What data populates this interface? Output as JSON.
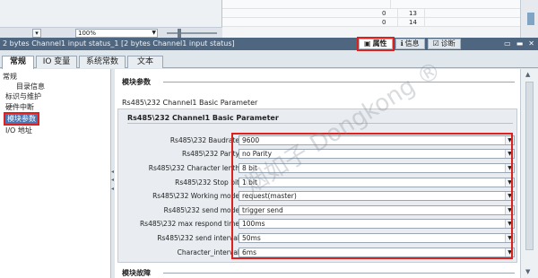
{
  "toolbar": {
    "zoom_value": "100%",
    "table_rows": [
      {
        "col1": "",
        "col2": "",
        "col3": ""
      },
      {
        "col1": "0",
        "col2": "13",
        "col3": ""
      },
      {
        "col1": "0",
        "col2": "14",
        "col3": ""
      }
    ]
  },
  "infobar": {
    "title": "2 bytes Channel1 input status_1 [2 bytes Channel1 input status]",
    "tabs": [
      {
        "label": "属性",
        "icon": "properties-icon"
      },
      {
        "label": "信息",
        "icon": "info-icon"
      },
      {
        "label": "诊断",
        "icon": "diagnostics-icon"
      }
    ]
  },
  "subtabs": [
    "常规",
    "IO 变量",
    "系统常数",
    "文本"
  ],
  "nav": {
    "items": [
      "常规",
      "目录信息",
      "标识与维护",
      "硬件中断",
      "模块参数",
      "I/O 地址"
    ]
  },
  "main": {
    "section_title": "模块参数",
    "group_title": "Rs485\\232 Channel1 Basic Parameter",
    "box_title": "Rs485\\232 Channel1 Basic Parameter",
    "params": [
      {
        "label": "Rs485\\232 Baudrate",
        "value": "9600"
      },
      {
        "label": "Rs485\\232 Parity",
        "value": "no Parity"
      },
      {
        "label": "Rs485\\232 Character lenth",
        "value": "8 bit"
      },
      {
        "label": "Rs485\\232 Stop bit",
        "value": "1 bit"
      },
      {
        "label": "Rs485\\232 Working mode",
        "value": "request(master)"
      },
      {
        "label": "Rs485\\232 send mode",
        "value": "trigger send"
      },
      {
        "label": "Rs485\\232 max respond time",
        "value": "100ms"
      },
      {
        "label": "Rs485\\232 send interval",
        "value": "50ms"
      },
      {
        "label": "Character_interval",
        "value": "6ms"
      }
    ],
    "footer_section": "模块故障"
  },
  "watermark": "烟如子 Dongkong ®",
  "colors": {
    "highlight": "#e0201c",
    "accent": "#4a77b4",
    "infobar": "#4e6680"
  }
}
